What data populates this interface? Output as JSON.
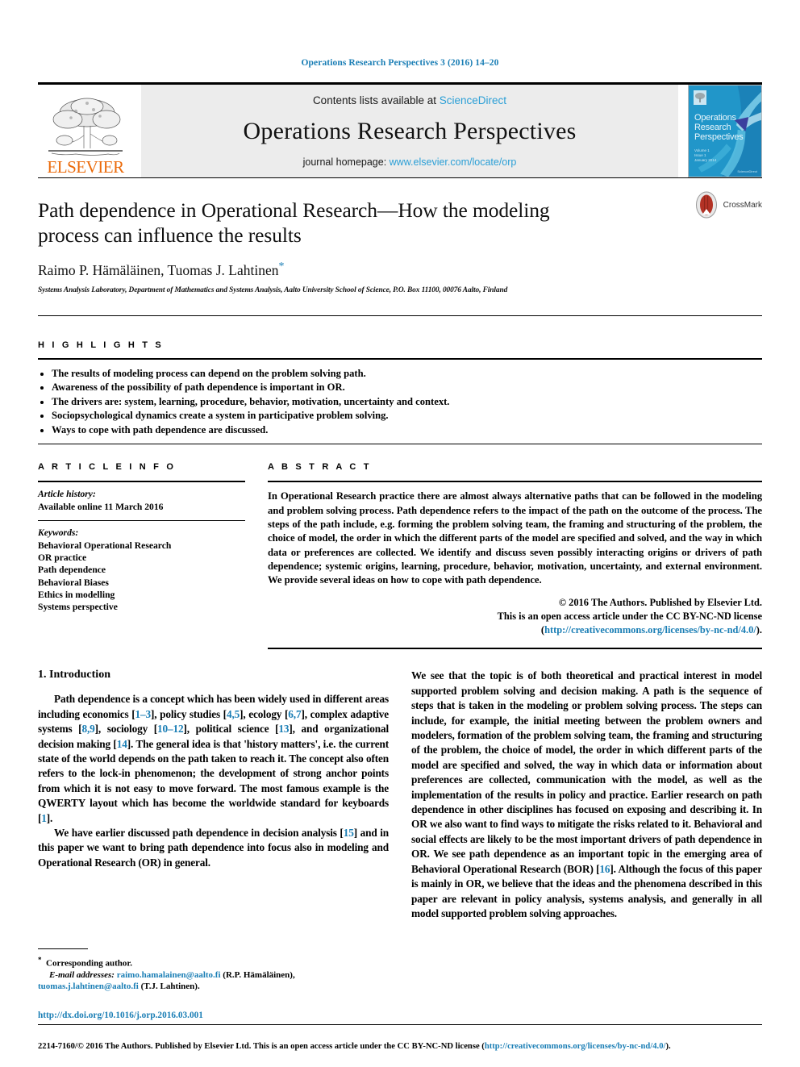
{
  "running_head": "Operations Research Perspectives 3 (2016) 14–20",
  "masthead": {
    "publisher_logo_text": "ELSEVIER",
    "contents_prefix": "Contents lists available at ",
    "contents_link": "ScienceDirect",
    "journal_title": "Operations Research Perspectives",
    "homepage_prefix": "journal homepage: ",
    "homepage_url": "www.elsevier.com/locate/orp",
    "cover": {
      "line1": "Operations",
      "line2": "Research",
      "line3": "Perspectives",
      "volume": "Volume 1",
      "issue": "Issue 1",
      "date": "January 2014",
      "bottom": "ScienceDirect"
    }
  },
  "article": {
    "title": "Path dependence in Operational Research—How the modeling process can influence the results",
    "authors": "Raimo P. Hämäläinen, Tuomas J. Lahtinen",
    "corresponding_marker": "*",
    "affiliation": "Systems Analysis Laboratory, Department of Mathematics and Systems Analysis, Aalto University School of Science, P.O. Box 11100, 00076 Aalto, Finland",
    "crossmark_label": "CrossMark"
  },
  "highlights": {
    "heading": "H I G H L I G H T S",
    "items": [
      "The results of modeling process can depend on the problem solving path.",
      "Awareness of the possibility of path dependence is important in OR.",
      "The drivers are: system, learning, procedure, behavior, motivation, uncertainty and context.",
      "Sociopsychological dynamics create a system in participative problem solving.",
      "Ways to cope with path dependence are discussed."
    ]
  },
  "article_info": {
    "heading": "A R T I C L E    I N F O",
    "history_label": "Article history:",
    "history_value": "Available online 11 March 2016",
    "keywords_label": "Keywords:",
    "keywords": [
      "Behavioral Operational Research",
      "OR practice",
      "Path dependence",
      "Behavioral Biases",
      "Ethics in modelling",
      "Systems perspective"
    ]
  },
  "abstract": {
    "heading": "A B S T R A C T",
    "text": "In Operational Research practice there are almost always alternative paths that can be followed in the modeling and problem solving process. Path dependence refers to the impact of the path on the outcome of the process. The steps of the path include, e.g. forming the problem solving team, the framing and structuring of the problem, the choice of model, the order in which the different parts of the model are specified and solved, and the way in which data or preferences are collected. We identify and discuss seven possibly interacting origins or drivers of path dependence; systemic origins, learning, procedure, behavior, motivation, uncertainty, and external environment. We provide several ideas on how to cope with path dependence.",
    "copyright_line1": "© 2016 The Authors. Published by Elsevier Ltd.",
    "copyright_line2": "This is an open access article under the CC BY-NC-ND license",
    "copyright_link_open": "(",
    "copyright_link": "http://creativecommons.org/licenses/by-nc-nd/4.0/",
    "copyright_link_close": ")."
  },
  "body": {
    "section_heading": "1. Introduction",
    "left_paragraphs": [
      "Path dependence is a concept which has been widely used in different areas including economics [1–3], policy studies [4,5], ecology [6,7], complex adaptive systems [8,9], sociology [10–12], political science [13], and organizational decision making [14]. The general idea is that 'history matters', i.e. the current state of the world depends on the path taken to reach it. The concept also often refers to the lock-in phenomenon; the development of strong anchor points from which it is not easy to move forward. The most famous example is the QWERTY layout which has become the worldwide standard for keyboards [1].",
      "We have earlier discussed path dependence in decision analysis [15] and in this paper we want to bring path dependence into focus also in modeling and Operational Research (OR) in general."
    ],
    "right_paragraphs": [
      "We see that the topic is of both theoretical and practical interest in model supported problem solving and decision making. A path is the sequence of steps that is taken in the modeling or problem solving process. The steps can include, for example, the initial meeting between the problem owners and modelers, formation of the problem solving team, the framing and structuring of the problem, the choice of model, the order in which different parts of the model are specified and solved, the way in which data or information about preferences are collected, communication with the model, as well as the implementation of the results in policy and practice. Earlier research on path dependence in other disciplines has focused on exposing and describing it. In OR we also want to find ways to mitigate the risks related to it. Behavioral and social effects are likely to be the most important drivers of path dependence in OR. We see path dependence as an important topic in the emerging area of Behavioral Operational Research (BOR) [16]. Although the focus of this paper is mainly in OR, we believe that the ideas and the phenomena described in this paper are relevant in policy analysis, systems analysis, and generally in all model supported problem solving approaches."
    ]
  },
  "footnote": {
    "star": "*",
    "corresponding": "Corresponding author.",
    "email_label": "E-mail addresses:",
    "email1": "raimo.hamalainen@aalto.fi",
    "email1_owner": "(R.P. Hämäläinen),",
    "email2": "tuomas.j.lahtinen@aalto.fi",
    "email2_owner": "(T.J. Lahtinen).",
    "doi": "http://dx.doi.org/10.1016/j.orp.2016.03.001"
  },
  "footer": {
    "text_before": "2214-7160/© 2016 The Authors. Published by Elsevier Ltd. This is an open access article under the CC BY-NC-ND license (",
    "link": "http://creativecommons.org/licenses/by-nc-nd/4.0/",
    "text_after": ")."
  },
  "colors": {
    "link_blue": "#1a7eb5",
    "sciencedirect_blue": "#2b9fd6",
    "elsevier_orange": "#EB6A0A",
    "cover_blue": "#1c8fc4"
  }
}
